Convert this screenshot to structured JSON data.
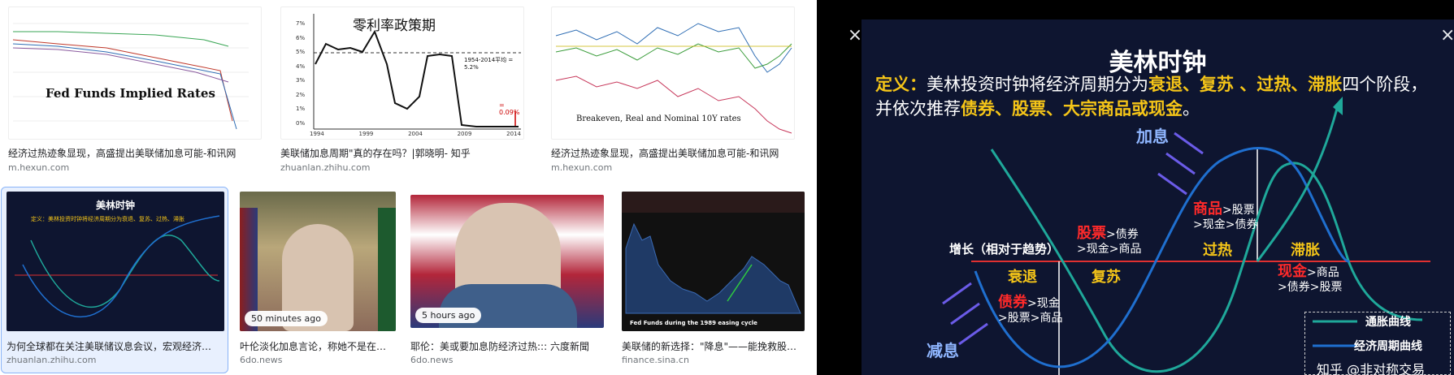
{
  "results": [
    {
      "caption": "经济过热迹象显现，高盛提出美联储加息可能-和讯网",
      "source": "m.hexun.com",
      "chart_title": "Fed Funds Implied Rates"
    },
    {
      "caption": "美联储加息周期\"真的存在吗？|郭晓明- 知乎",
      "source": "zhuanlan.zhihu.com",
      "chart_title": "零利率政策期",
      "axis": [
        "7%",
        "6%",
        "5%",
        "4%",
        "3%",
        "2%",
        "1%",
        "0%"
      ],
      "years": [
        "1994",
        "1999",
        "2004",
        "2009",
        "2014"
      ],
      "avg_note": "1954-2014平均 = 5.2%",
      "low_note": "= 0.09%"
    },
    {
      "caption": "经济过热迹象显现，高盛提出美联储加息可能-和讯网",
      "source": "m.hexun.com",
      "chart_title": "Breakeven, Real and Nominal 10Y rates"
    },
    {
      "caption": "为何全球都在关注美联储议息会议，宏观经济…",
      "source": "zhuanlan.zhihu.com",
      "chart_title": "美林时钟"
    },
    {
      "caption": "叶伦淡化加息言论，称她不是在…",
      "source": "6do.news",
      "badge": "50 minutes ago"
    },
    {
      "caption": "耶伦：美或要加息防经济过热::: 六度新聞",
      "source": "6do.news",
      "badge": "5 hours ago"
    },
    {
      "caption": "美联储的新选择：\"降息\"——能挽救股…",
      "source": "finance.sina.cn",
      "chart_title": "Fed Funds during the 1989 easing cycle"
    }
  ],
  "viewer": {
    "close_icon": "×",
    "title": "美林时钟",
    "def_label": "定义：",
    "def_text_a": "美林投资时钟将经济周期分为",
    "def_phases": "衰退、复苏 、过热、滞胀",
    "def_text_b": "四个阶段，",
    "def_text_c": "并依次推荐",
    "def_assets": "债券、股票、大宗商品或现金",
    "def_end": "。",
    "hike": "加息",
    "cut": "减息",
    "growth": "增长（相对于趋势）",
    "phase_recession": "衰退",
    "phase_recovery": "复苏",
    "phase_overheat": "过热",
    "phase_stagflation": "滞胀",
    "bond_top": "债券",
    "bond_rest1": ">现金",
    "bond_rest2": ">股票>商品",
    "stock_top": "股票",
    "stock_rest1": ">债券",
    "stock_rest2": ">现金>商品",
    "comm_top": "商品",
    "comm_rest1": ">股票",
    "comm_rest2": ">现金>债券",
    "cash_top": "现金",
    "cash_rest1": ">商品",
    "cash_rest2": ">债券>股票",
    "legend_inflation": "通胀曲线",
    "legend_cycle": "经济周期曲线",
    "watermark": "知乎 @非对称交易"
  },
  "colors": {
    "accent_yellow": "#f5c518",
    "red": "#ff2a2a",
    "teal": "#1fa89a",
    "blue": "#1f6fcf",
    "bg": "#0e1530"
  }
}
